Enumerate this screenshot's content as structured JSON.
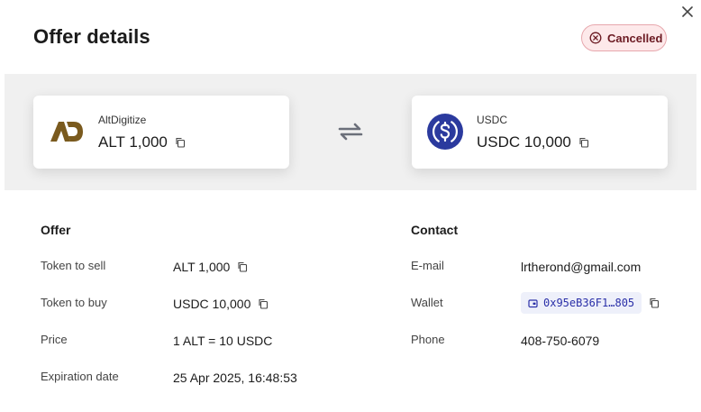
{
  "dialog": {
    "title": "Offer details",
    "status": "Cancelled",
    "colors": {
      "status_bg": "#fde9ea",
      "status_border": "#e7a7ad",
      "status_text": "#6b1a22",
      "usdc_blue": "#2b3a9e",
      "alt_gold": "#7a5a1e"
    }
  },
  "sell_card": {
    "name": "AltDigitize",
    "amount": "ALT 1,000",
    "icon": "altdigitize-logo-icon"
  },
  "buy_card": {
    "name": "USDC",
    "amount": "USDC 10,000",
    "icon": "usdc-logo-icon"
  },
  "offer": {
    "title": "Offer",
    "rows": [
      {
        "label": "Token to sell",
        "value": "ALT 1,000"
      },
      {
        "label": "Token to buy",
        "value": "USDC 10,000"
      },
      {
        "label": "Price",
        "value": "1 ALT = 10 USDC"
      },
      {
        "label": "Expiration date",
        "value": "25 Apr 2025, 16:48:53"
      }
    ]
  },
  "contact": {
    "title": "Contact",
    "email_label": "E-mail",
    "email": "lrtherond@gmail.com",
    "wallet_label": "Wallet",
    "wallet": "0x95eB36F1…805",
    "phone_label": "Phone",
    "phone": "408-750-6079"
  }
}
